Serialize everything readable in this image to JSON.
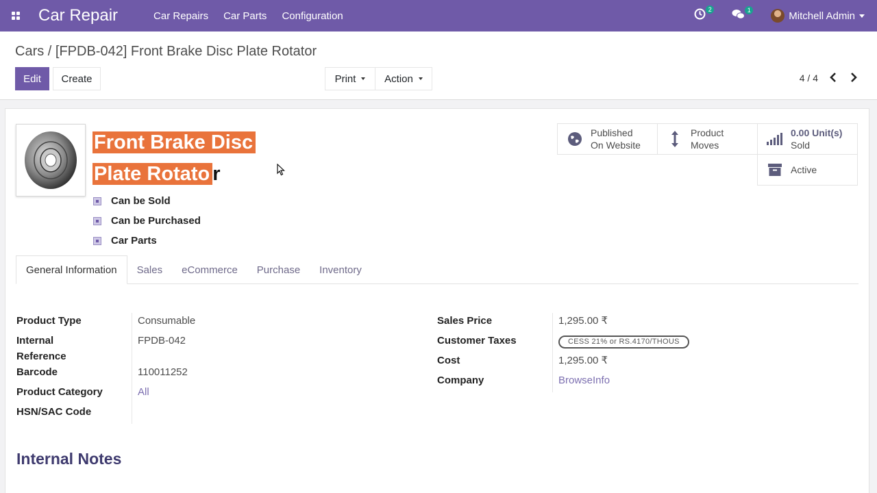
{
  "navbar": {
    "brand": "Car Repair",
    "menu": [
      "Car Repairs",
      "Car Parts",
      "Configuration"
    ],
    "activity_count": "2",
    "message_count": "1",
    "user_name": "Mitchell Admin"
  },
  "control": {
    "breadcrumb": "Cars / [FPDB-042] Front Brake Disc Plate Rotator",
    "edit_label": "Edit",
    "create_label": "Create",
    "print_label": "Print",
    "action_label": "Action",
    "pager": "4 / 4"
  },
  "product": {
    "name_line1": "Front Brake Disc",
    "name_line2_hl": "Plate Rotato",
    "name_line2_rest": "r",
    "checks": [
      "Can be Sold",
      "Can be Purchased",
      "Car Parts"
    ]
  },
  "smart_buttons": {
    "published_l1": "Published",
    "published_l2": "On Website",
    "moves_l1": "Product",
    "moves_l2": "Moves",
    "sold_value": "0.00",
    "sold_unit": "Unit(s)",
    "sold_label": "Sold",
    "active_label": "Active"
  },
  "tabs": [
    "General Information",
    "Sales",
    "eCommerce",
    "Purchase",
    "Inventory"
  ],
  "left_fields": {
    "product_type_label": "Product Type",
    "product_type": "Consumable",
    "internal_ref_label": "Internal Reference",
    "internal_ref": "FPDB-042",
    "barcode_label": "Barcode",
    "barcode": "110011252",
    "category_label": "Product Category",
    "category": "All",
    "hsn_label": "HSN/SAC Code",
    "hsn": ""
  },
  "right_fields": {
    "sales_price_label": "Sales Price",
    "sales_price": "1,295.00 ₹",
    "customer_taxes_label": "Customer Taxes",
    "customer_taxes": "CESS 21% or RS.4170/THOUS",
    "cost_label": "Cost",
    "cost": "1,295.00 ₹",
    "company_label": "Company",
    "company": "BrowseInfo"
  },
  "notes_title": "Internal Notes",
  "colors": {
    "brand": "#6f5aa8",
    "highlight": "#e9733b",
    "published": "#28a745"
  }
}
